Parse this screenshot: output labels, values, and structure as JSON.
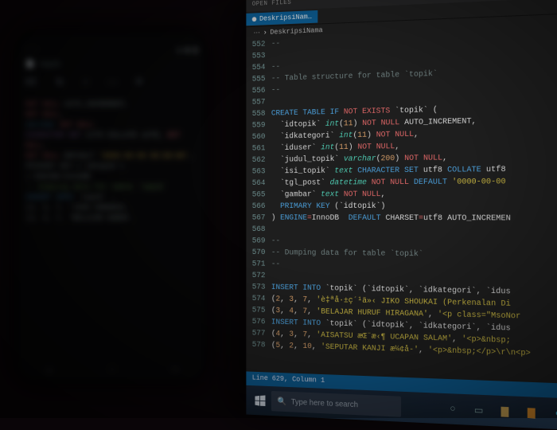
{
  "editor": {
    "open_files_label": "OPEN FILES",
    "tab_label": "DeskripsiNam…",
    "breadcrumb_icon": "⋯",
    "breadcrumb_file": "DeskripsiNama",
    "status": "Line 629, Column 1",
    "gutter_start": 552,
    "lines": [
      [
        {
          "c": "k-gray",
          "t": "--"
        }
      ],
      [
        {
          "c": "k-gray",
          "t": ""
        }
      ],
      [
        {
          "c": "k-gray",
          "t": "--"
        }
      ],
      [
        {
          "c": "k-gray",
          "t": "-- Table structure for table `topik`"
        }
      ],
      [
        {
          "c": "k-gray",
          "t": "--"
        }
      ],
      [
        {
          "c": "k-gray",
          "t": ""
        }
      ],
      [
        {
          "c": "k-blue",
          "t": "CREATE TABLE IF "
        },
        {
          "c": "k-red",
          "t": "NOT EXISTS"
        },
        {
          "c": "k-white",
          "t": " `topik` ("
        }
      ],
      [
        {
          "c": "k-white",
          "t": "  `idtopik` "
        },
        {
          "c": "k-teal",
          "t": "int"
        },
        {
          "c": "k-white",
          "t": "("
        },
        {
          "c": "k-orange",
          "t": "11"
        },
        {
          "c": "k-white",
          "t": ") "
        },
        {
          "c": "k-red",
          "t": "NOT NULL"
        },
        {
          "c": "k-white",
          "t": " AUTO_INCREMENT,"
        }
      ],
      [
        {
          "c": "k-white",
          "t": "  `idkategori` "
        },
        {
          "c": "k-teal",
          "t": "int"
        },
        {
          "c": "k-white",
          "t": "("
        },
        {
          "c": "k-orange",
          "t": "11"
        },
        {
          "c": "k-white",
          "t": ") "
        },
        {
          "c": "k-red",
          "t": "NOT NULL"
        },
        {
          "c": "k-white",
          "t": ","
        }
      ],
      [
        {
          "c": "k-white",
          "t": "  `iduser` "
        },
        {
          "c": "k-teal",
          "t": "int"
        },
        {
          "c": "k-white",
          "t": "("
        },
        {
          "c": "k-orange",
          "t": "11"
        },
        {
          "c": "k-white",
          "t": ") "
        },
        {
          "c": "k-red",
          "t": "NOT NULL"
        },
        {
          "c": "k-white",
          "t": ","
        }
      ],
      [
        {
          "c": "k-white",
          "t": "  `judul_topik` "
        },
        {
          "c": "k-teal",
          "t": "varchar"
        },
        {
          "c": "k-white",
          "t": "("
        },
        {
          "c": "k-orange",
          "t": "200"
        },
        {
          "c": "k-white",
          "t": ") "
        },
        {
          "c": "k-red",
          "t": "NOT NULL"
        },
        {
          "c": "k-white",
          "t": ","
        }
      ],
      [
        {
          "c": "k-white",
          "t": "  `isi_topik` "
        },
        {
          "c": "k-teal",
          "t": "text "
        },
        {
          "c": "k-blue",
          "t": "CHARACTER SET"
        },
        {
          "c": "k-white",
          "t": " utf8 "
        },
        {
          "c": "k-blue",
          "t": "COLLATE"
        },
        {
          "c": "k-white",
          "t": " utf8"
        }
      ],
      [
        {
          "c": "k-white",
          "t": "  `tgl_post` "
        },
        {
          "c": "k-teal",
          "t": "datetime "
        },
        {
          "c": "k-red",
          "t": "NOT NULL "
        },
        {
          "c": "k-blue",
          "t": "DEFAULT "
        },
        {
          "c": "k-yellow",
          "t": "'0000-00-00"
        }
      ],
      [
        {
          "c": "k-white",
          "t": "  `gambar` "
        },
        {
          "c": "k-teal",
          "t": "text "
        },
        {
          "c": "k-red",
          "t": "NOT NULL"
        },
        {
          "c": "k-white",
          "t": ","
        }
      ],
      [
        {
          "c": "k-blue",
          "t": "  PRIMARY KEY"
        },
        {
          "c": "k-white",
          "t": " (`idtopik`)"
        }
      ],
      [
        {
          "c": "k-white",
          "t": ") "
        },
        {
          "c": "k-blue",
          "t": "ENGINE"
        },
        {
          "c": "k-red",
          "t": "="
        },
        {
          "c": "k-white",
          "t": "InnoDB  "
        },
        {
          "c": "k-blue",
          "t": "DEFAULT "
        },
        {
          "c": "k-white",
          "t": "CHARSET"
        },
        {
          "c": "k-red",
          "t": "="
        },
        {
          "c": "k-white",
          "t": "utf8 AUTO_INCREMEN"
        }
      ],
      [
        {
          "c": "k-gray",
          "t": ""
        }
      ],
      [
        {
          "c": "k-gray",
          "t": "--"
        }
      ],
      [
        {
          "c": "k-gray",
          "t": "-- Dumping data for table `topik`"
        }
      ],
      [
        {
          "c": "k-gray",
          "t": "--"
        }
      ],
      [
        {
          "c": "k-gray",
          "t": ""
        }
      ],
      [
        {
          "c": "k-blue",
          "t": "INSERT INTO"
        },
        {
          "c": "k-white",
          "t": " `topik` (`idtopik`, `idkategori`, `idus"
        }
      ],
      [
        {
          "c": "k-white",
          "t": "("
        },
        {
          "c": "k-orange",
          "t": "2"
        },
        {
          "c": "k-white",
          "t": ", "
        },
        {
          "c": "k-orange",
          "t": "3"
        },
        {
          "c": "k-white",
          "t": ", "
        },
        {
          "c": "k-orange",
          "t": "7"
        },
        {
          "c": "k-white",
          "t": ", "
        },
        {
          "c": "k-yellow",
          "t": "'è‡ªå·±ç´¹ä»‹ JIKO SHOUKAI (Perkenalan Di"
        }
      ],
      [
        {
          "c": "k-white",
          "t": "("
        },
        {
          "c": "k-orange",
          "t": "3"
        },
        {
          "c": "k-white",
          "t": ", "
        },
        {
          "c": "k-orange",
          "t": "4"
        },
        {
          "c": "k-white",
          "t": ", "
        },
        {
          "c": "k-orange",
          "t": "7"
        },
        {
          "c": "k-white",
          "t": ", "
        },
        {
          "c": "k-yellow",
          "t": "'BELAJAR HURUF HIRAGANA'"
        },
        {
          "c": "k-white",
          "t": ", "
        },
        {
          "c": "k-yellow",
          "t": "'<p class=\"MsoNor"
        }
      ],
      [
        {
          "c": "k-blue",
          "t": "INSERT INTO"
        },
        {
          "c": "k-white",
          "t": " `topik` (`idtopik`, `idkategori`, `idus"
        }
      ],
      [
        {
          "c": "k-white",
          "t": "("
        },
        {
          "c": "k-orange",
          "t": "4"
        },
        {
          "c": "k-white",
          "t": ", "
        },
        {
          "c": "k-orange",
          "t": "3"
        },
        {
          "c": "k-white",
          "t": ", "
        },
        {
          "c": "k-orange",
          "t": "7"
        },
        {
          "c": "k-white",
          "t": ", "
        },
        {
          "c": "k-yellow",
          "t": "'AISATSU æŒ¨æ‹¶ UCAPAN SALAM'"
        },
        {
          "c": "k-white",
          "t": ", "
        },
        {
          "c": "k-yellow",
          "t": "'<p>&nbsp;"
        }
      ],
      [
        {
          "c": "k-white",
          "t": "("
        },
        {
          "c": "k-orange",
          "t": "5"
        },
        {
          "c": "k-white",
          "t": ", "
        },
        {
          "c": "k-orange",
          "t": "2"
        },
        {
          "c": "k-white",
          "t": ", "
        },
        {
          "c": "k-orange",
          "t": "10"
        },
        {
          "c": "k-white",
          "t": ", "
        },
        {
          "c": "k-yellow",
          "t": "'SEPUTAR KANJI æ¼¢å­-'"
        },
        {
          "c": "k-white",
          "t": ", "
        },
        {
          "c": "k-yellow",
          "t": "'<p>&nbsp;</p>\\r\\n<p>"
        }
      ]
    ]
  },
  "taskbar": {
    "search_placeholder": "Type here to search",
    "icons": [
      {
        "name": "cortana-icon",
        "bg": "transparent",
        "glyph": "○",
        "color": "#8aa"
      },
      {
        "name": "taskview-icon",
        "bg": "transparent",
        "glyph": "▭",
        "color": "#8aa"
      },
      {
        "name": "explorer-icon",
        "bg": "#caa455",
        "glyph": "▇",
        "color": "#caa455"
      },
      {
        "name": "sublime-icon",
        "bg": "#d88b2a",
        "glyph": "▇",
        "color": "#d88b2a"
      },
      {
        "name": "edge-icon",
        "bg": "#0b88c4",
        "glyph": "●",
        "color": "#3ac1e8"
      }
    ]
  },
  "phone": {
    "time": "···",
    "tab": "topik",
    "icons": [
      "AI",
      "↻",
      "⌕",
      "⋯",
      "≡"
    ],
    "lines": [
      [
        {
          "c": "pk-red",
          "t": "NOT NULL"
        },
        {
          "c": "",
          "t": " AUTO_INCREMENT,"
        }
      ],
      [
        {
          "c": "pk-red",
          "t": "NOT NULL"
        },
        {
          "c": "",
          "t": ","
        }
      ],
      [
        {
          "c": "pk-blu",
          "t": "varchar"
        },
        {
          "c": "",
          "t": " "
        },
        {
          "c": "pk-red",
          "t": "NOT NULL"
        }
      ],
      [
        {
          "c": "pk-pur",
          "t": "CHARACTER SET"
        },
        {
          "c": "",
          "t": " utf8 COLLATE utf8_ "
        },
        {
          "c": "pk-red",
          "t": "NOT NULL"
        },
        {
          "c": "",
          "t": ","
        }
      ],
      [
        {
          "c": "pk-red",
          "t": "NOT NULL"
        },
        {
          "c": "",
          "t": " DEFAULT "
        },
        {
          "c": "pk-yel",
          "t": "'0000-00-00 00:00:00'"
        },
        {
          "c": "",
          "t": ","
        }
      ],
      [
        {
          "c": "",
          "t": "PRIMARY KEY (`idtopik`)"
        }
      ],
      [
        {
          "c": "",
          "t": ") ENGINE=InnoDB"
        }
      ],
      [
        {
          "c": "",
          "t": ""
        }
      ],
      [
        {
          "c": "pk-grn",
          "t": "-- Dumping data for table `topik`"
        }
      ],
      [
        {
          "c": "",
          "t": ""
        }
      ],
      [
        {
          "c": "pk-blu",
          "t": "INSERT INTO"
        },
        {
          "c": "",
          "t": " `topik` …"
        }
      ],
      [
        {
          "c": "",
          "t": "(2, 3, 7, 'JIKO SHOUKAI…"
        }
      ],
      [
        {
          "c": "",
          "t": "(3, 4, 7, 'BELAJAR HURUF…"
        }
      ]
    ],
    "nav": [
      "◁",
      "○",
      "□"
    ]
  }
}
